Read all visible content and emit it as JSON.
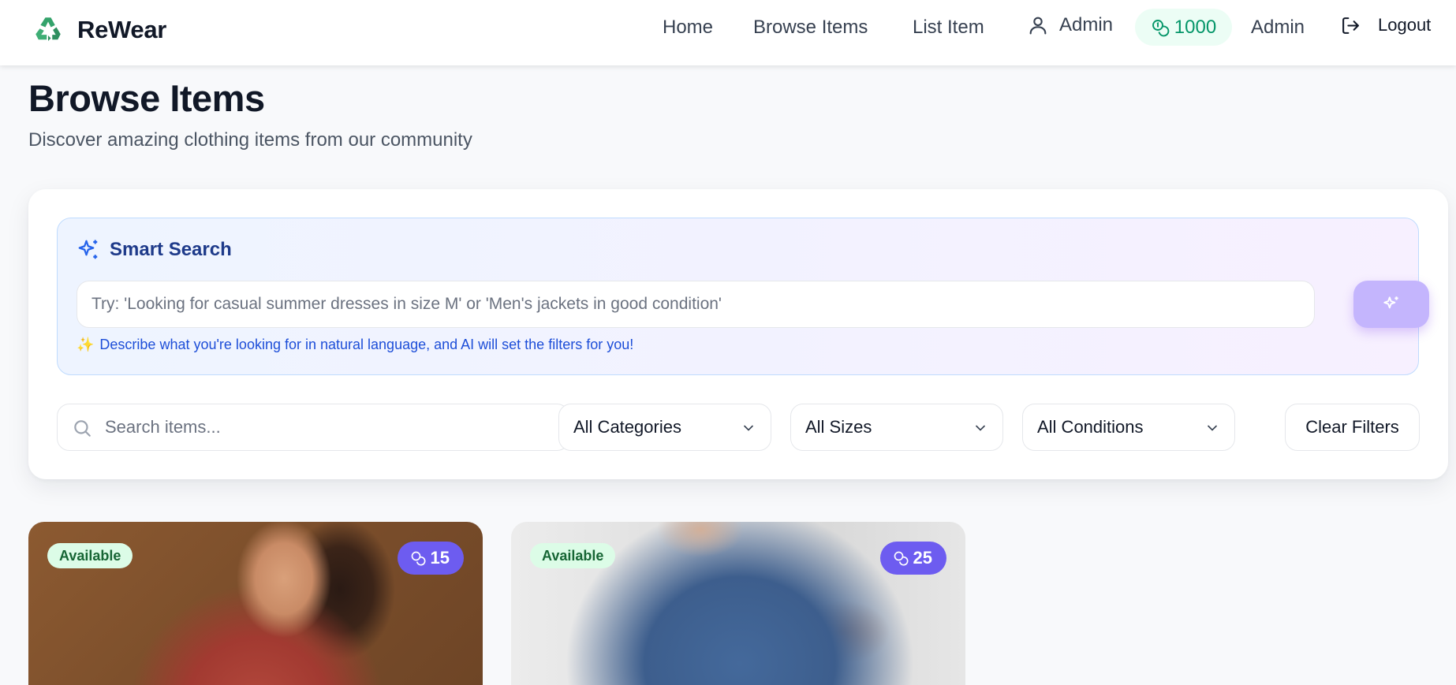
{
  "header": {
    "brand": "ReWear",
    "nav": {
      "home": "Home",
      "browse": "Browse Items",
      "list": "List Item"
    },
    "user_label": "Admin",
    "points": "1000",
    "role_label": "Admin",
    "logout_label": "Logout"
  },
  "page": {
    "title": "Browse Items",
    "subtitle": "Discover amazing clothing items from our community"
  },
  "smart_search": {
    "title": "Smart Search",
    "placeholder": "Try: 'Looking for casual summer dresses in size M' or 'Men's jackets in good condition'",
    "hint_icon": "✨",
    "hint": "Describe what you're looking for in natural language, and AI will set the filters for you!"
  },
  "filters": {
    "search_placeholder": "Search items...",
    "category": "All Categories",
    "size": "All Sizes",
    "condition": "All Conditions",
    "clear_label": "Clear Filters"
  },
  "items": [
    {
      "status": "Available",
      "points": "15"
    },
    {
      "status": "Available",
      "points": "25"
    }
  ],
  "colors": {
    "brand_green": "#059669",
    "accent_purple": "#6d5cf0",
    "smart_blue": "#1e3a8a"
  }
}
